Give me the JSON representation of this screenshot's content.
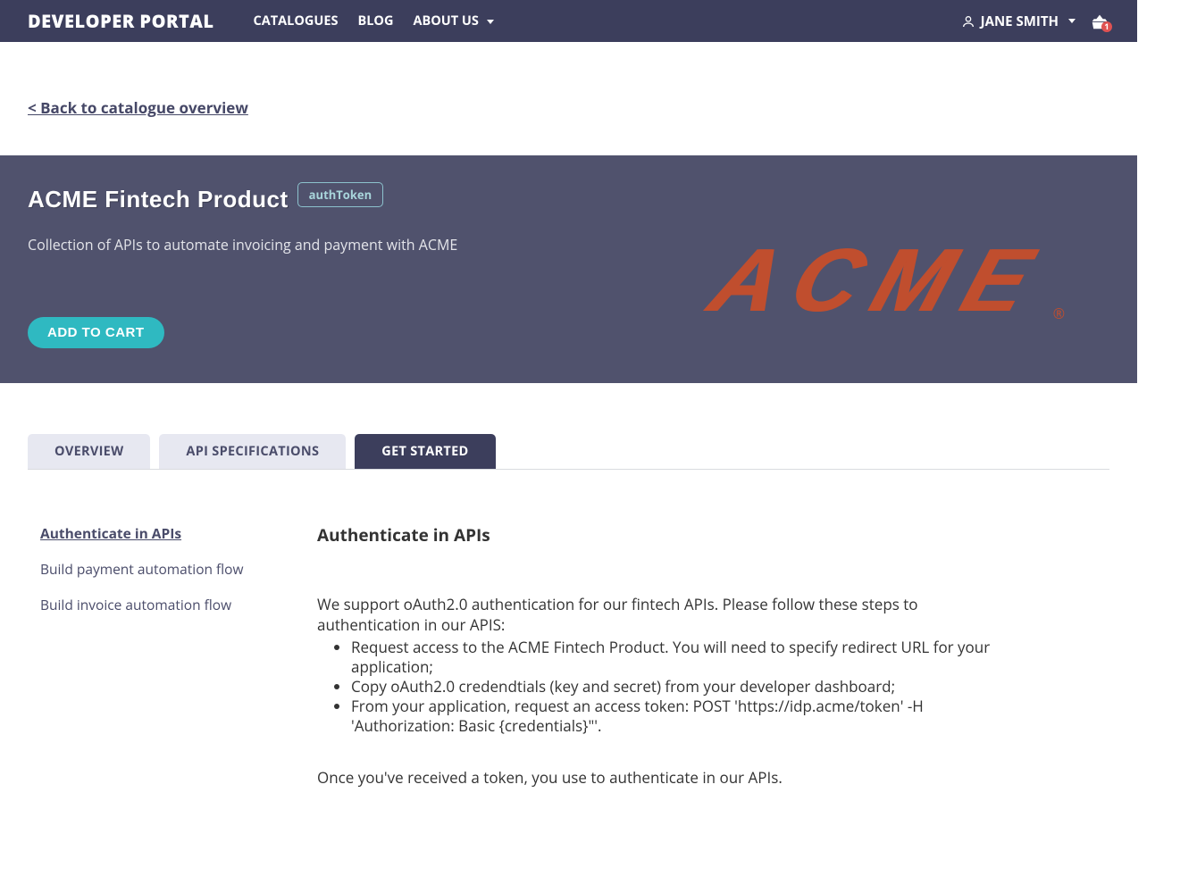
{
  "header": {
    "brand": "DEVELOPER PORTAL",
    "nav": [
      "CATALOGUES",
      "BLOG",
      "ABOUT US"
    ],
    "user_name": "JANE SMITH",
    "cart_count": "1"
  },
  "backlink": "< Back to catalogue overview",
  "hero": {
    "title": "ACME Fintech Product",
    "badge": "authToken",
    "description": "Collection of APIs to automate invoicing and payment with ACME",
    "add_to_cart": "ADD TO CART",
    "logo_text": "ACME",
    "logo_reg": "®"
  },
  "tabs": [
    {
      "label": "OVERVIEW",
      "active": false
    },
    {
      "label": "API SPECIFICATIONS",
      "active": false
    },
    {
      "label": "GET STARTED",
      "active": true
    }
  ],
  "toc": [
    {
      "label": "Authenticate in APIs",
      "current": true
    },
    {
      "label": "Build payment automation flow",
      "current": false
    },
    {
      "label": "Build invoice automation flow",
      "current": false
    }
  ],
  "article": {
    "heading": "Authenticate in APIs",
    "intro": "We support oAuth2.0 authentication for our fintech APIs. Please follow these steps to authentication in our APIS:",
    "steps": [
      "Request access to the ACME Fintech Product. You will need to specify redirect URL for your application;",
      "Copy oAuth2.0 credendtials (key and secret) from your developer dashboard;",
      "From your application, request an access token: POST 'https://idp.acme/token' -H 'Authorization: Basic {credentials}\"'."
    ],
    "outro": "Once you've received a token, you use to authenticate in our APIs."
  }
}
